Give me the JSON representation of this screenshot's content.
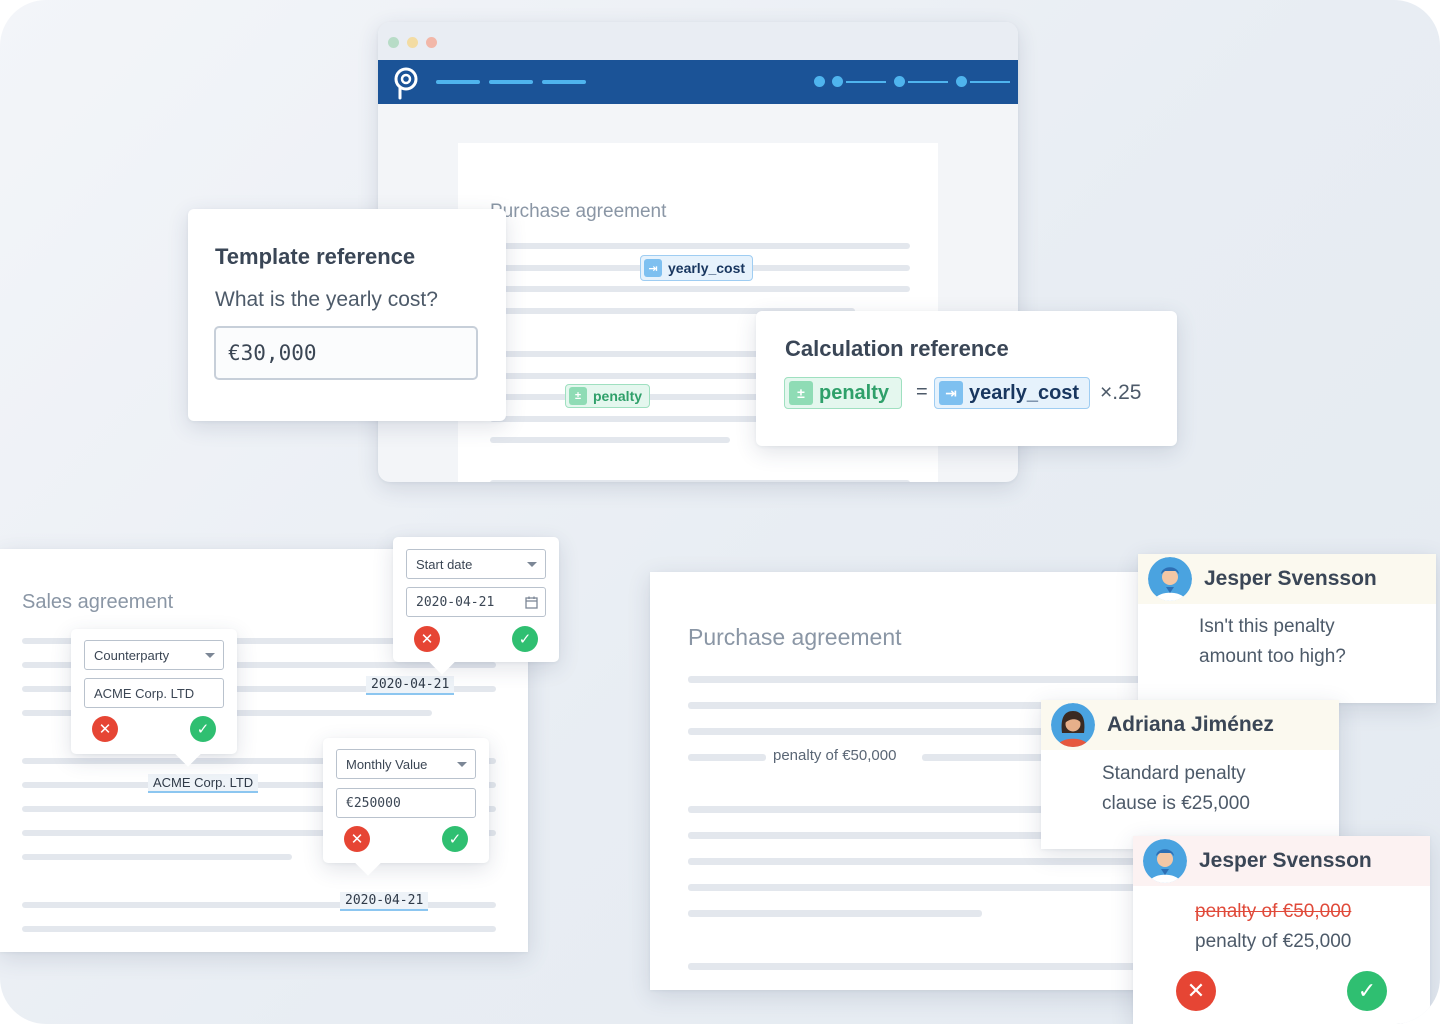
{
  "top_doc": {
    "title": "Purchase agreement",
    "chip_yearly_cost": "yearly_cost",
    "chip_penalty": "penalty"
  },
  "template_reference": {
    "title": "Template reference",
    "question": "What is the yearly cost?",
    "value": "€30,000"
  },
  "calculation_reference": {
    "title": "Calculation reference",
    "left_chip": "penalty",
    "equals": "=",
    "right_chip": "yearly_cost",
    "multiplier": "×.25"
  },
  "sales_doc": {
    "title": "Sales agreement",
    "counterparty_popover": {
      "select_label": "Counterparty",
      "value": "ACME Corp. LTD"
    },
    "counterparty_tag": "ACME Corp. LTD",
    "start_date_popover": {
      "select_label": "Start date",
      "value": "2020-04-21"
    },
    "start_date_tag": "2020-04-21",
    "monthly_popover": {
      "select_label": "Monthly Value",
      "value": "€250000"
    },
    "monthly_tag": "2020-04-21"
  },
  "purchase_doc": {
    "title": "Purchase agreement",
    "inline_text": "penalty of €50,000"
  },
  "comments": [
    {
      "author": "Jesper Svensson",
      "text_line1": "Isn't this penalty",
      "text_line2": "amount too high?"
    },
    {
      "author": "Adriana Jiménez",
      "text_line1": "Standard penalty",
      "text_line2": "clause is €25,000"
    },
    {
      "author": "Jesper Svensson",
      "removed": "penalty of €50,000",
      "added": "penalty of €25,000"
    }
  ],
  "colors": {
    "appbar": "#1b5397",
    "accent": "#4fb4ee",
    "reject": "#e64534",
    "accept": "#2fbf71"
  }
}
